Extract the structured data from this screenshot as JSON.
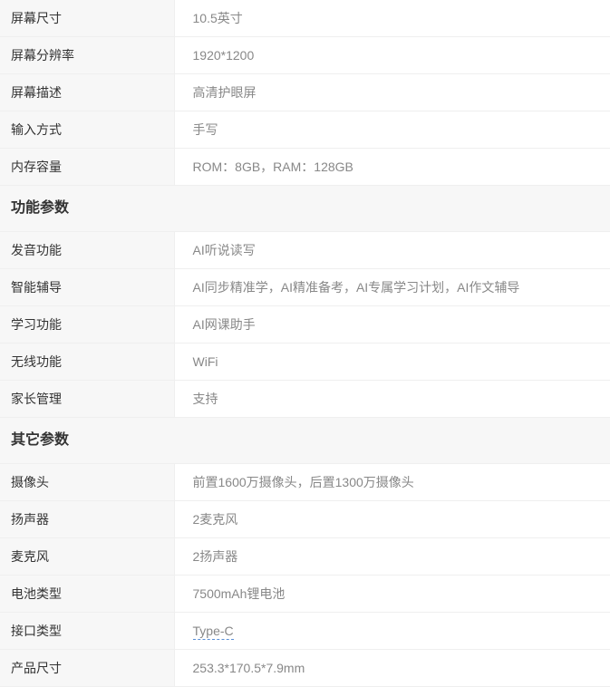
{
  "display": [
    {
      "key": "屏幕尺寸",
      "value": "10.5英寸"
    },
    {
      "key": "屏幕分辨率",
      "value": "1920*1200"
    },
    {
      "key": "屏幕描述",
      "value": "高清护眼屏"
    },
    {
      "key": "输入方式",
      "value": "手写"
    },
    {
      "key": "内存容量",
      "value": "ROM：8GB，RAM：128GB"
    }
  ],
  "function_section": {
    "title": "功能参数",
    "rows": [
      {
        "key": "发音功能",
        "value": "AI听说读写"
      },
      {
        "key": "智能辅导",
        "value": "AI同步精准学，AI精准备考，AI专属学习计划，AI作文辅导"
      },
      {
        "key": "学习功能",
        "value": "AI网课助手"
      },
      {
        "key": "无线功能",
        "value": "WiFi"
      },
      {
        "key": "家长管理",
        "value": "支持"
      }
    ]
  },
  "other_section": {
    "title": "其它参数",
    "rows": [
      {
        "key": "摄像头",
        "value": "前置1600万摄像头，后置1300万摄像头"
      },
      {
        "key": "扬声器",
        "value": "2麦克风"
      },
      {
        "key": "麦克风",
        "value": "2扬声器"
      },
      {
        "key": "电池类型",
        "value": "7500mAh锂电池"
      },
      {
        "key": "接口类型",
        "value": "Type-C"
      },
      {
        "key": "产品尺寸",
        "value": "253.3*170.5*7.9mm"
      }
    ]
  },
  "colors": {
    "key_background": "#f7f7f7",
    "border": "#efefef",
    "key_text": "#333333",
    "value_text": "#888888",
    "link_underline": "#5a8fd6"
  }
}
